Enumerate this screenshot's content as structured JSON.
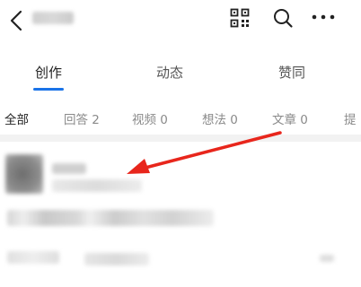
{
  "header": {
    "back_icon": "chevron-left-icon",
    "qr_icon": "qr-code-icon",
    "search_icon": "search-icon",
    "more_icon": "more-horizontal-icon"
  },
  "tabs": [
    {
      "label": "创作",
      "active": true
    },
    {
      "label": "动态",
      "active": false
    },
    {
      "label": "赞同",
      "active": false
    }
  ],
  "filters": [
    {
      "label": "全部",
      "active": true
    },
    {
      "label": "回答 2",
      "active": false
    },
    {
      "label": "视频 0",
      "active": false
    },
    {
      "label": "想法 0",
      "active": false
    },
    {
      "label": "文章 0",
      "active": false
    },
    {
      "label": "提",
      "active": false
    }
  ],
  "colors": {
    "accent": "#1a73e8",
    "arrow": "#e8261c"
  }
}
